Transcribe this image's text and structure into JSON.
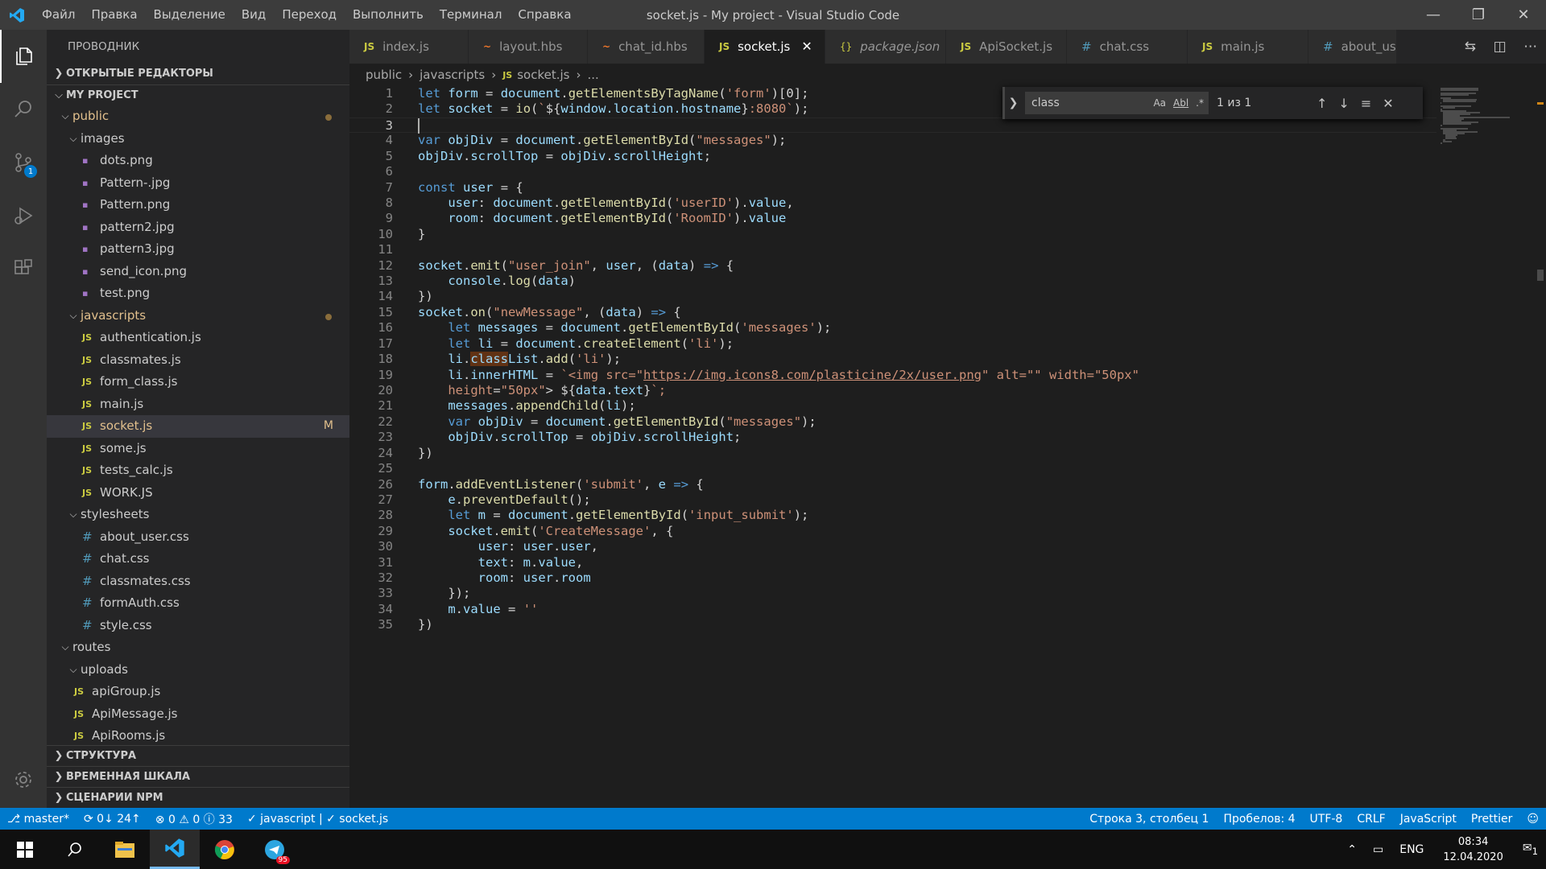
{
  "titlebar": {
    "menu": [
      "Файл",
      "Правка",
      "Выделение",
      "Вид",
      "Переход",
      "Выполнить",
      "Терминал",
      "Справка"
    ],
    "title": "socket.js - My project - Visual Studio Code"
  },
  "activity": {
    "scm_badge": "1"
  },
  "sidebar": {
    "title": "ПРОВОДНИК",
    "open_editors": "ОТКРЫТЫЕ РЕДАКТОРЫ",
    "project": "MY PROJECT",
    "tree": [
      {
        "label": "public",
        "kind": "folder",
        "depth": 1
      },
      {
        "label": "images",
        "kind": "folder",
        "depth": 2
      },
      {
        "label": "dots.png",
        "kind": "img",
        "depth": 3
      },
      {
        "label": "Pattern-.jpg",
        "kind": "img",
        "depth": 3
      },
      {
        "label": "Pattern.png",
        "kind": "img",
        "depth": 3
      },
      {
        "label": "pattern2.jpg",
        "kind": "img",
        "depth": 3
      },
      {
        "label": "pattern3.jpg",
        "kind": "img",
        "depth": 3
      },
      {
        "label": "send_icon.png",
        "kind": "img",
        "depth": 3
      },
      {
        "label": "test.png",
        "kind": "img",
        "depth": 3
      },
      {
        "label": "javascripts",
        "kind": "folder",
        "depth": 2
      },
      {
        "label": "authentication.js",
        "kind": "js",
        "depth": 3
      },
      {
        "label": "classmates.js",
        "kind": "js",
        "depth": 3
      },
      {
        "label": "form_class.js",
        "kind": "js",
        "depth": 3
      },
      {
        "label": "main.js",
        "kind": "js",
        "depth": 3
      },
      {
        "label": "socket.js",
        "kind": "js",
        "depth": 3,
        "mark": "M"
      },
      {
        "label": "some.js",
        "kind": "js",
        "depth": 3
      },
      {
        "label": "tests_calc.js",
        "kind": "js",
        "depth": 3
      },
      {
        "label": "WORK.JS",
        "kind": "js",
        "depth": 3
      },
      {
        "label": "stylesheets",
        "kind": "folder",
        "depth": 2
      },
      {
        "label": "about_user.css",
        "kind": "css",
        "depth": 3
      },
      {
        "label": "chat.css",
        "kind": "css",
        "depth": 3
      },
      {
        "label": "classmates.css",
        "kind": "css",
        "depth": 3
      },
      {
        "label": "formAuth.css",
        "kind": "css",
        "depth": 3
      },
      {
        "label": "style.css",
        "kind": "css",
        "depth": 3
      },
      {
        "label": "routes",
        "kind": "folder",
        "depth": 1
      },
      {
        "label": "uploads",
        "kind": "folder",
        "depth": 2
      },
      {
        "label": "apiGroup.js",
        "kind": "js",
        "depth": 2
      },
      {
        "label": "ApiMessage.js",
        "kind": "js",
        "depth": 2
      },
      {
        "label": "ApiRooms.js",
        "kind": "js",
        "depth": 2
      }
    ],
    "bottom_sections": [
      "СТРУКТУРА",
      "ВРЕМЕННАЯ ШКАЛА",
      "СЦЕНАРИИ NPM"
    ]
  },
  "tabs": [
    {
      "label": "index.js",
      "icon": "JS",
      "kind": "js"
    },
    {
      "label": "layout.hbs",
      "icon": "~",
      "kind": "hbs"
    },
    {
      "label": "chat_id.hbs",
      "icon": "~",
      "kind": "hbs"
    },
    {
      "label": "socket.js",
      "icon": "JS",
      "kind": "js",
      "active": true
    },
    {
      "label": "package.json",
      "icon": "{}",
      "kind": "json"
    },
    {
      "label": "ApiSocket.js",
      "icon": "JS",
      "kind": "js"
    },
    {
      "label": "chat.css",
      "icon": "#",
      "kind": "css"
    },
    {
      "label": "main.js",
      "icon": "JS",
      "kind": "js"
    },
    {
      "label": "about_user",
      "icon": "#",
      "kind": "css"
    }
  ],
  "breadcrumb": {
    "parts": [
      "public",
      "javascripts",
      "socket.js",
      "..."
    ]
  },
  "find": {
    "query": "class",
    "count": "1 из 1",
    "opt_case": "Aa",
    "opt_word": "Abl",
    "opt_regex": ".*"
  },
  "code": {
    "lines": [
      "let form = document.getElementsByTagName('form')[0];",
      "let socket = io(`${window.location.hostname}:8080`);",
      "",
      "var objDiv = document.getElementById(\"messages\");",
      "objDiv.scrollTop = objDiv.scrollHeight;",
      "",
      "const user = {",
      "    user: document.getElementById('userID').value,",
      "    room: document.getElementById('RoomID').value",
      "}",
      "",
      "socket.emit(\"user_join\", user, (data) => {",
      "    console.log(data)",
      "})",
      "socket.on(\"newMessage\", (data) => {",
      "    let messages = document.getElementById('messages');",
      "    let li = document.createElement('li');",
      "    li.classList.add('li');",
      "    li.innerHTML = `<img src=\"https://img.icons8.com/plasticine/2x/user.png\" alt=\"\" width=\"50px\"",
      "    height=\"50px\"> ${data.text}`;",
      "    messages.appendChild(li);",
      "    var objDiv = document.getElementById(\"messages\");",
      "    objDiv.scrollTop = objDiv.scrollHeight;",
      "})",
      "",
      "form.addEventListener('submit', e => {",
      "    e.preventDefault();",
      "    let m = document.getElementById('input_submit');",
      "    socket.emit('CreateMessage', {",
      "        user: user.user,",
      "        text: m.value,",
      "        room: user.room",
      "    });",
      "    m.value = ''",
      "})"
    ],
    "current_line": 3
  },
  "statusbar": {
    "branch": "master*",
    "sync": "0↓ 24↑",
    "problems": "⊗ 0 ⚠ 0 ⓘ 33",
    "lint": "✓ javascript | ✓ socket.js",
    "position": "Строка 3, столбец 1",
    "spaces": "Пробелов: 4",
    "encoding": "UTF-8",
    "eol": "CRLF",
    "language": "JavaScript",
    "formatter": "Prettier"
  },
  "taskbar": {
    "lang": "ENG",
    "time": "08:34",
    "date": "12.04.2020",
    "telegram_badge": "95",
    "notif_count": "1"
  },
  "colors": {
    "statusbar": "#007acc",
    "titlebar": "#3c3c3c",
    "editor_bg": "#1e1e1e"
  }
}
